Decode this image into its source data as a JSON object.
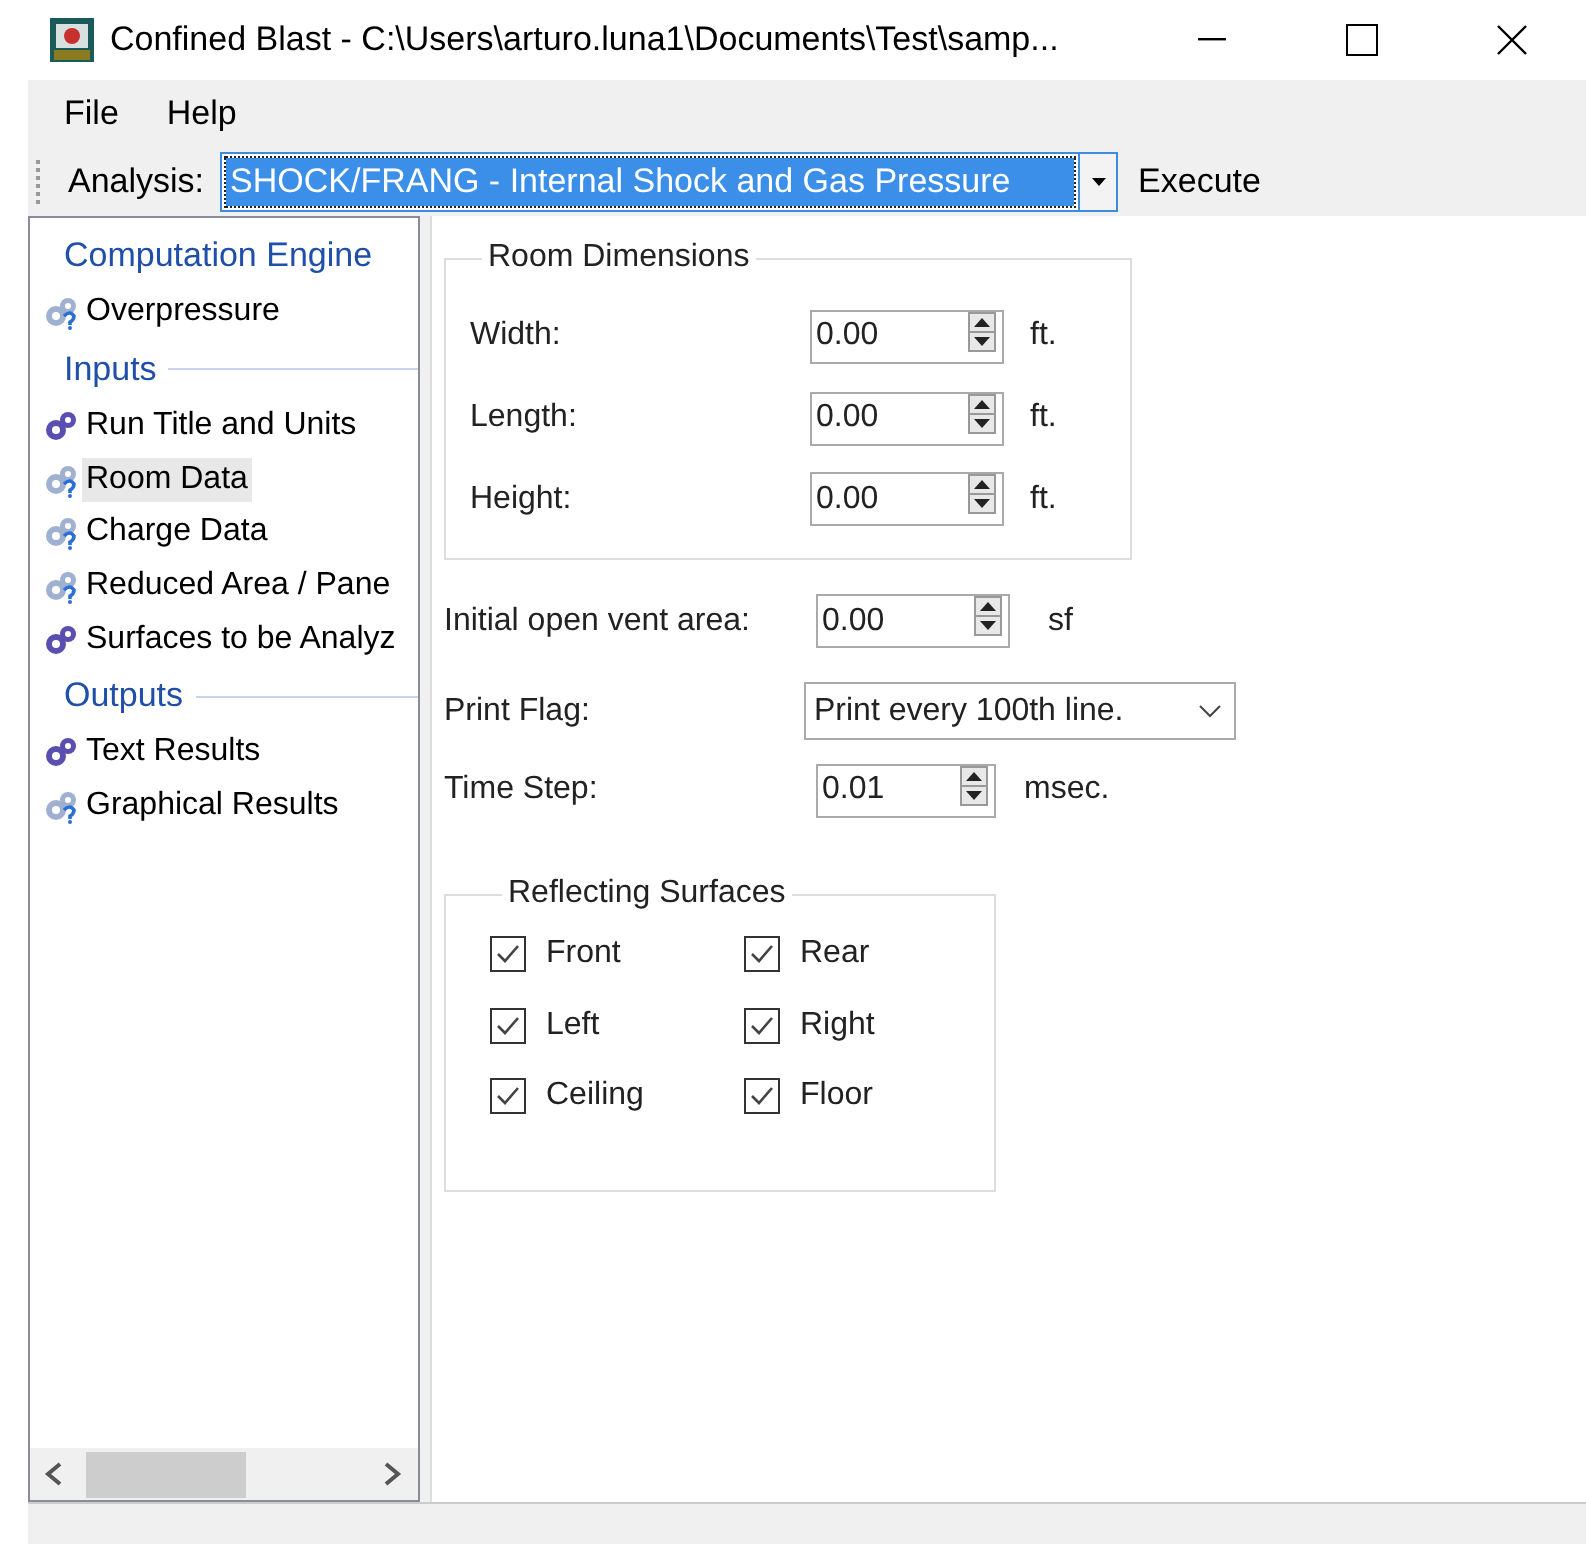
{
  "window": {
    "title": "Confined Blast - C:\\Users\\arturo.luna1\\Documents\\Test\\samp..."
  },
  "menu": [
    "File",
    "Help"
  ],
  "toolbar": {
    "label": "Analysis:",
    "analysis": "SHOCK/FRANG - Internal Shock and Gas Pressure",
    "execute": "Execute"
  },
  "sidebar": {
    "sections": [
      {
        "title": "Computation Engine",
        "items": [
          {
            "label": "Overpressure",
            "complete": false,
            "selected": false
          }
        ]
      },
      {
        "title": "Inputs",
        "items": [
          {
            "label": "Run Title and Units",
            "complete": true,
            "selected": false
          },
          {
            "label": "Room Data",
            "complete": false,
            "selected": true
          },
          {
            "label": "Charge Data",
            "complete": false,
            "selected": false
          },
          {
            "label": "Reduced Area / Pane",
            "complete": false,
            "selected": false
          },
          {
            "label": "Surfaces to be Analyz",
            "complete": true,
            "selected": false
          }
        ]
      },
      {
        "title": "Outputs",
        "items": [
          {
            "label": "Text Results",
            "complete": true,
            "selected": false
          },
          {
            "label": "Graphical Results",
            "complete": false,
            "selected": false
          }
        ]
      }
    ]
  },
  "room_dimensions": {
    "title": "Room Dimensions",
    "fields": [
      {
        "label": "Width:",
        "value": "0.00",
        "unit": "ft."
      },
      {
        "label": "Length:",
        "value": "0.00",
        "unit": "ft."
      },
      {
        "label": "Height:",
        "value": "0.00",
        "unit": "ft."
      }
    ]
  },
  "vent": {
    "label": "Initial open vent area:",
    "value": "0.00",
    "unit": "sf"
  },
  "print_flag": {
    "label": "Print Flag:",
    "value": "Print every 100th line."
  },
  "time_step": {
    "label": "Time Step:",
    "value": "0.01",
    "unit": "msec."
  },
  "reflecting_surfaces": {
    "title": "Reflecting Surfaces",
    "items": [
      {
        "label": "Front",
        "checked": true
      },
      {
        "label": "Rear",
        "checked": true
      },
      {
        "label": "Left",
        "checked": true
      },
      {
        "label": "Right",
        "checked": true
      },
      {
        "label": "Ceiling",
        "checked": true
      },
      {
        "label": "Floor",
        "checked": true
      }
    ]
  }
}
